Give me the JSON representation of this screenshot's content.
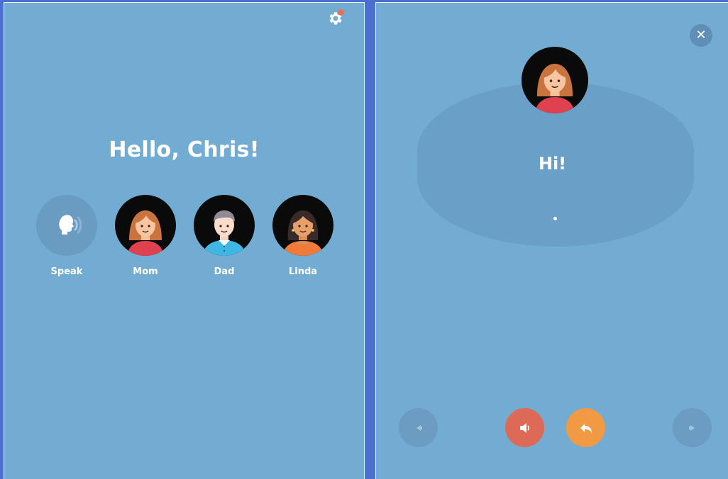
{
  "home": {
    "greeting": "Hello, Chris!",
    "settings_icon": "gear-icon",
    "notification_color": "#e2705c",
    "contacts": [
      {
        "label": "Speak",
        "icon": "speaking-head-icon"
      },
      {
        "label": "Mom",
        "icon": "avatar-mom"
      },
      {
        "label": "Dad",
        "icon": "avatar-dad"
      },
      {
        "label": "Linda",
        "icon": "avatar-linda"
      }
    ]
  },
  "conversation": {
    "contact_icon": "avatar-mom",
    "message": "Hi!",
    "close_icon": "close-icon",
    "controls": [
      {
        "icon": "previous-arrow-icon"
      },
      {
        "icon": "speaker-icon",
        "color": "#dd6a57"
      },
      {
        "icon": "reply-icon",
        "color": "#f29943"
      },
      {
        "icon": "next-arrow-icon"
      }
    ]
  },
  "colors": {
    "panel_bg": "#73acd3",
    "frame_bg": "#4a6fcf"
  }
}
